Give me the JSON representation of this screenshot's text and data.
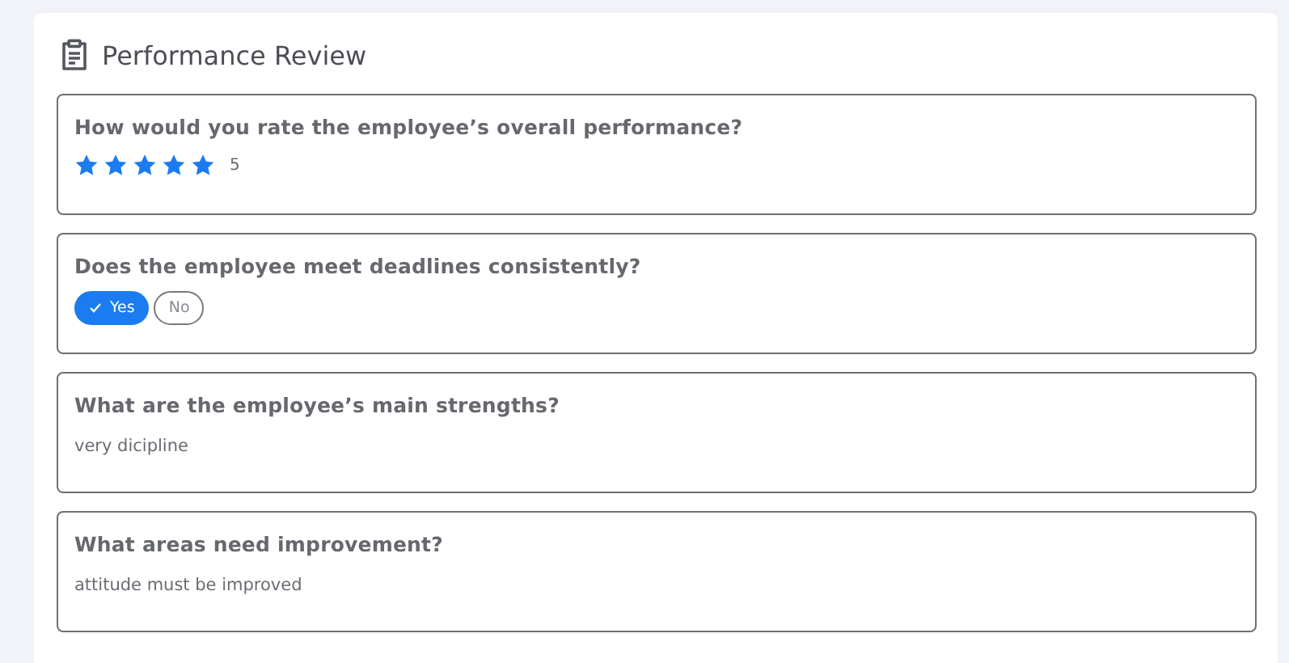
{
  "title": "Performance Review",
  "questions": [
    {
      "kind": "rating",
      "question": "How would you rate the employee’s overall performance?",
      "stars": 5,
      "reading": "5"
    },
    {
      "kind": "choice",
      "question": "Does the employee meet deadlines consistently?",
      "options": [
        {
          "label": "Yes",
          "selected": true
        },
        {
          "label": "No",
          "selected": false
        }
      ]
    },
    {
      "kind": "text",
      "question": "What are the employee’s main strengths?",
      "answer": "very dicipline"
    },
    {
      "kind": "text",
      "question": "What areas need improvement?",
      "answer": "attitude must be improved"
    }
  ]
}
